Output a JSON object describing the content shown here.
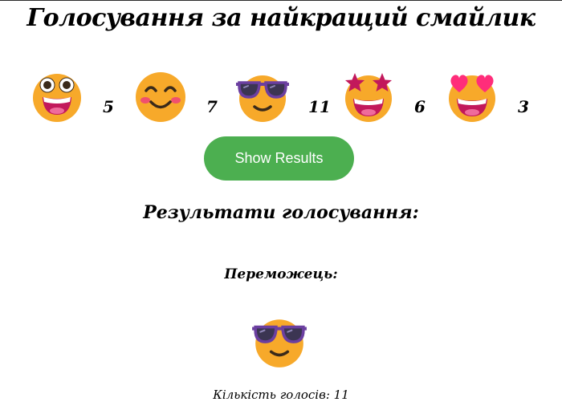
{
  "title": "Голосування за найкращий смайлик",
  "emojis": [
    {
      "icon": "grinning-face-big-eyes-icon",
      "count": "5"
    },
    {
      "icon": "smiling-face-blush-icon",
      "count": "7"
    },
    {
      "icon": "sunglasses-face-icon",
      "count": "11"
    },
    {
      "icon": "star-struck-face-icon",
      "count": "6"
    },
    {
      "icon": "heart-eyes-face-icon",
      "count": "3"
    }
  ],
  "show_button_label": "Show Results",
  "results": {
    "heading": "Результати голосування:",
    "winner_label": "Переможець:",
    "winner_icon": "sunglasses-face-icon",
    "votes_text": "Кількість голосів: 11"
  },
  "colors": {
    "button": "#4caf50",
    "face": "#f7a92a",
    "mouth": "#c2185b",
    "glasses": "#6b3fa0",
    "heart": "#ff2d7a"
  }
}
